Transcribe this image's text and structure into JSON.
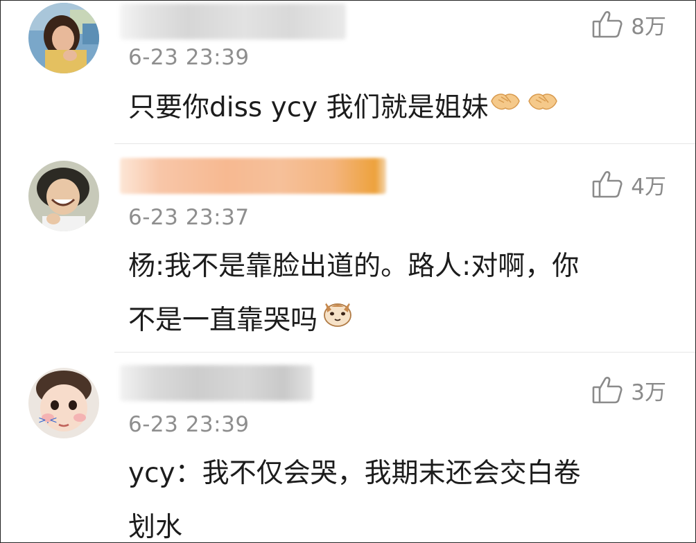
{
  "comments": [
    {
      "username": "",
      "timestamp": "6-23 23:39",
      "likes": "8万",
      "text": "只要你diss ycy 我们就是姐妹",
      "emojis": [
        "handshake-emoji",
        "handshake-emoji"
      ]
    },
    {
      "username": "",
      "timestamp": "6-23 23:37",
      "likes": "4万",
      "text_line1": "杨:我不是靠脸出道的。路人:对啊，你",
      "text_line2": "不是一直靠哭吗",
      "emojis": [
        "cat-emoji"
      ]
    },
    {
      "username": "",
      "timestamp": "6-23 23:39",
      "likes": "3万",
      "text_line1": "ycy：我不仅会哭，我期末还会交白卷",
      "text_line2": "划水"
    }
  ],
  "colors": {
    "timestamp": "#8e8e8e",
    "like": "#8a8a8a",
    "text": "#1c1c1c",
    "divider": "#e6e6e6"
  },
  "icons": {
    "like": "thumbs-up-icon"
  }
}
